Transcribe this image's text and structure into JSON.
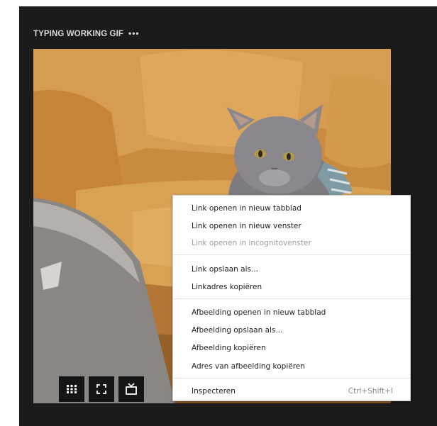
{
  "header": {
    "title": "TYPING WORKING GIF",
    "more_label": "•••"
  },
  "controls": {
    "grid_icon": "grid-icon",
    "fullscreen_icon": "fullscreen-icon",
    "tv_icon": "tv-icon"
  },
  "context_menu": {
    "items": [
      {
        "label": "Link openen in nieuw tabblad",
        "enabled": true
      },
      {
        "label": "Link openen in nieuw venster",
        "enabled": true
      },
      {
        "label": "Link openen in incognitovenster",
        "enabled": false
      },
      {
        "label": "Link opslaan als...",
        "enabled": true
      },
      {
        "label": "Linkadres kopiëren",
        "enabled": true
      },
      {
        "label": "Afbeelding openen in nieuw tabblad",
        "enabled": true
      },
      {
        "label": "Afbeelding opslaan als...",
        "enabled": true
      },
      {
        "label": "Afbeelding kopiëren",
        "enabled": true
      },
      {
        "label": "Adres van afbeelding kopiëren",
        "enabled": true
      },
      {
        "label": "Inspecteren",
        "enabled": true,
        "shortcut": "Ctrl+Shift+I"
      }
    ]
  }
}
